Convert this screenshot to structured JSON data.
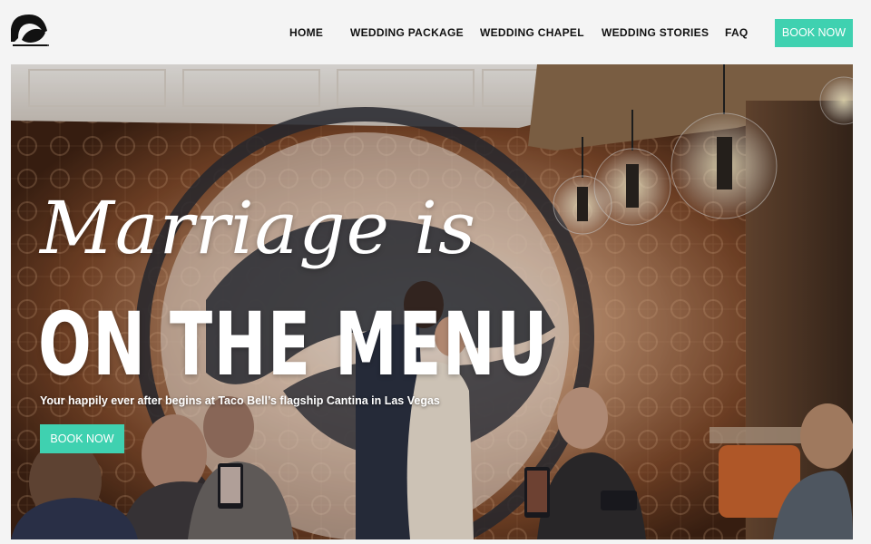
{
  "brand": {
    "accent_color": "#3fd1b0",
    "logo_icon": "bell-logo-icon"
  },
  "nav": {
    "home": "HOME",
    "wedding_package": "WEDDING PACKAGE",
    "wedding_chapel": "WEDDING CHAPEL",
    "wedding_stories": "WEDDING STORIES",
    "faq": "FAQ",
    "book_now": "BOOK NOW"
  },
  "hero": {
    "headline_script": "Marriage is",
    "headline_block": "ON THE MENU",
    "subline": "Your happily ever after begins at Taco Bell’s flagship Cantina in Las Vegas",
    "cta": "BOOK NOW"
  }
}
